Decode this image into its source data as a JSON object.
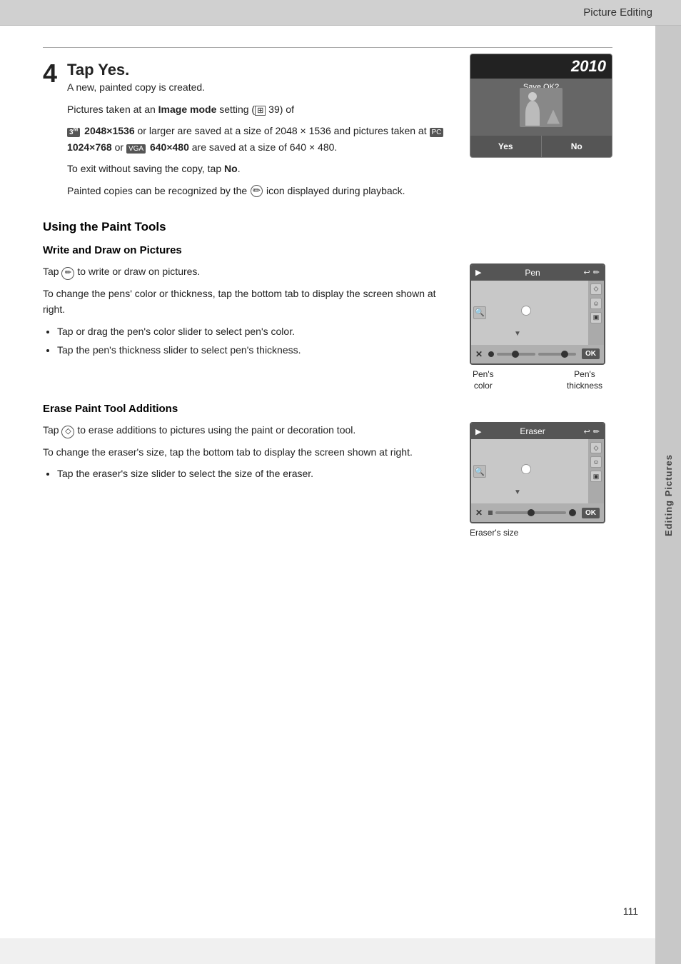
{
  "header": {
    "title": "Picture Editing"
  },
  "sidebar": {
    "label": "Editing Pictures"
  },
  "page_number": "111",
  "step4": {
    "number": "4",
    "title_prefix": "Tap ",
    "title_bold": "Yes",
    "title_suffix": ".",
    "desc1": "A new, painted copy is created.",
    "desc2_prefix": "Pictures taken at an ",
    "desc2_bold": "Image mode",
    "desc2_mid": " setting (",
    "desc2_icon": "⊞",
    "desc2_num": " 39) of",
    "desc3": "3M 2048×1536 or larger are saved at a size of 2048 × 1536 and pictures taken at PC 1024×768 or VGA 640×480 are saved at a size of 640 × 480.",
    "desc4_prefix": "To exit without saving the copy, tap ",
    "desc4_bold": "No",
    "desc4_suffix": ".",
    "desc5_prefix": "Painted copies can be recognized by the ",
    "desc5_icon": "✏",
    "desc5_suffix": " icon displayed during playback.",
    "camera_year": "2010",
    "camera_save": "Save OK?",
    "camera_yes": "Yes",
    "camera_no": "No"
  },
  "paint_tools": {
    "section_title": "Using the Paint Tools",
    "write_draw": {
      "sub_title": "Write and Draw on Pictures",
      "desc1_prefix": "Tap ",
      "desc1_icon": "✏",
      "desc1_suffix": " to write or draw on pictures.",
      "desc2": "To change the pens' color or thickness, tap the bottom tab to display the screen shown at right.",
      "bullets": [
        "Tap or drag the pen's color slider to select pen's color.",
        "Tap the pen's thickness slider to select pen's thickness."
      ],
      "pen_label": "Pen",
      "pen_color_label": "Pen's\ncolor",
      "pen_thickness_label": "Pen's\nthickness"
    },
    "erase": {
      "sub_title": "Erase Paint Tool Additions",
      "desc1_prefix": "Tap ",
      "desc1_icon": "◇",
      "desc1_suffix": " to erase additions to pictures using the paint or decoration tool.",
      "desc2": "To change the eraser's size, tap the bottom tab to display the screen shown at right.",
      "bullets": [
        "Tap the eraser's size slider to select the size of the eraser."
      ],
      "eraser_label": "Eraser",
      "eraser_size_label": "Eraser's size"
    }
  }
}
